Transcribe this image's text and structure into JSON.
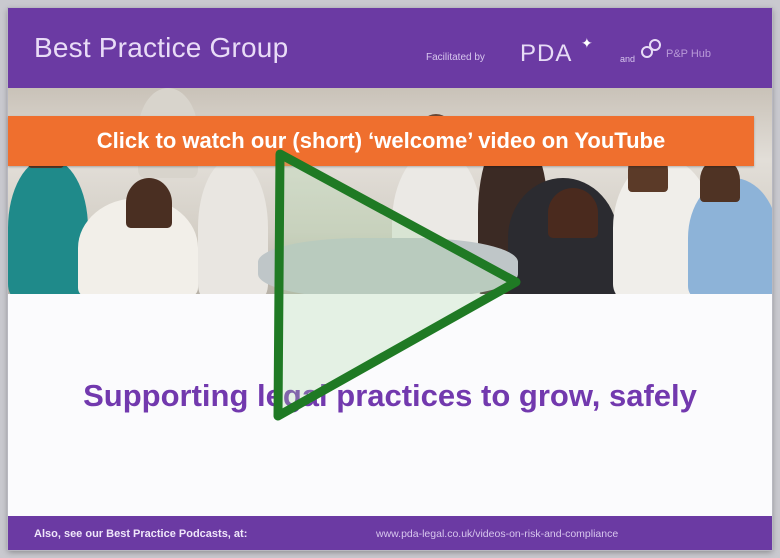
{
  "header": {
    "title": "Best Practice Group",
    "facilitated_label": "Facilitated by",
    "pda_logo_text": "PDA",
    "and_label": "and",
    "hub_logo_text": "P&P Hub"
  },
  "banner": {
    "text": "Click to watch our (short) ‘welcome’ video on YouTube"
  },
  "tagline": "Supporting legal practices to grow, safely",
  "footer": {
    "also_text": "Also, see our Best Practice Podcasts, at:",
    "url_text": "www.pda-legal.co.uk/videos-on-risk-and-compliance"
  },
  "colors": {
    "brand_purple": "#6b3aa3",
    "banner_orange": "#ef6f2e",
    "play_green": "#1f7a24",
    "tagline_purple": "#7239ae"
  },
  "icons": [
    "play-icon",
    "pda-bird-icon",
    "hub-icon"
  ]
}
